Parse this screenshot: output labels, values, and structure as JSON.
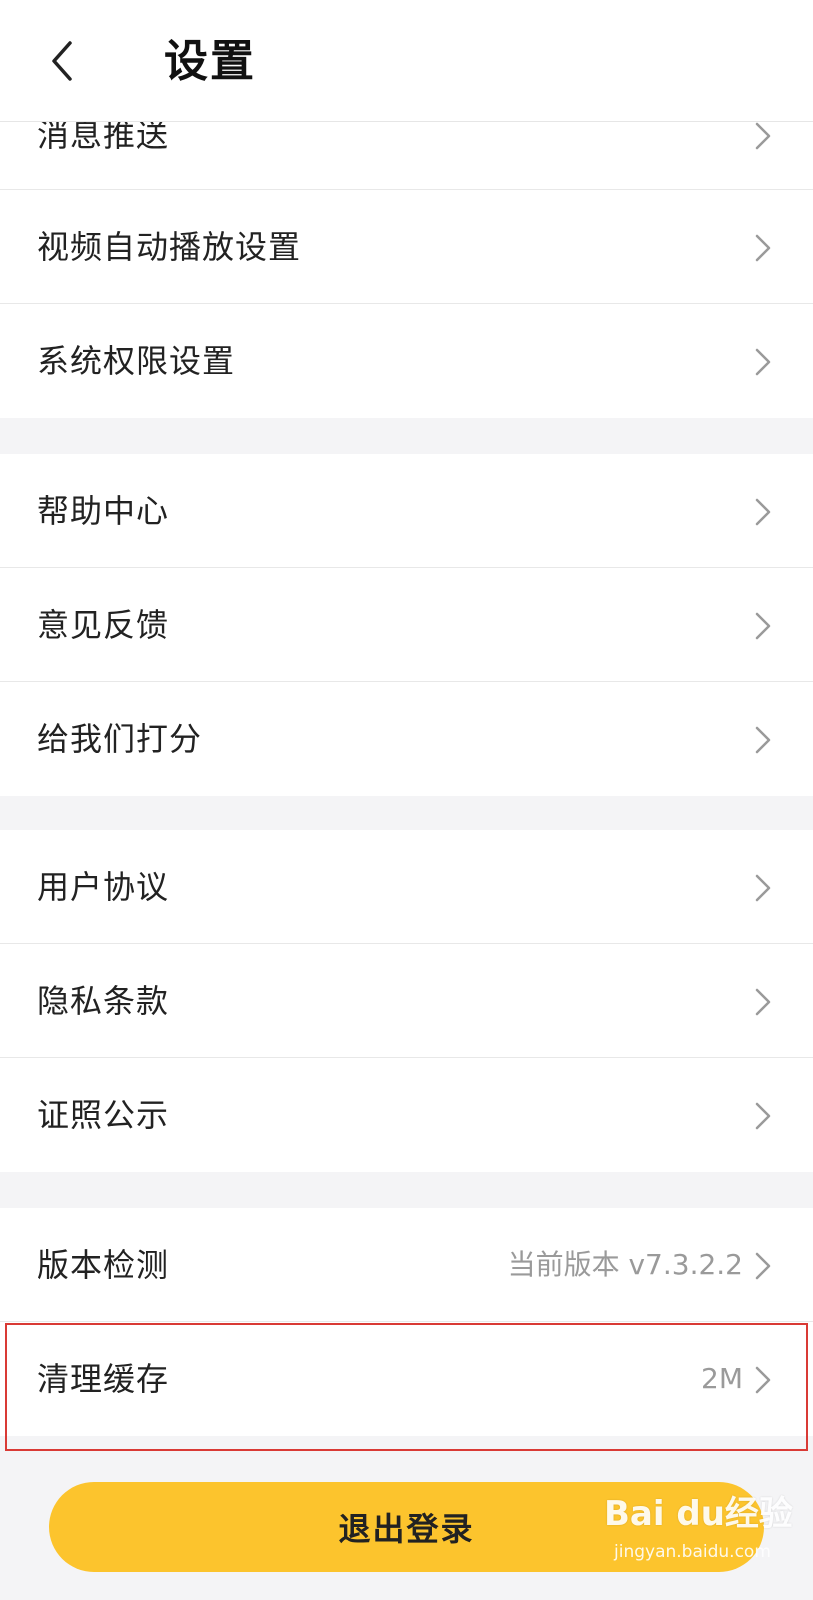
{
  "header": {
    "title": "设置",
    "back_icon": "chevron-left-icon"
  },
  "groups": [
    {
      "items": [
        {
          "label": "消息推送"
        },
        {
          "label": "视频自动播放设置"
        },
        {
          "label": "系统权限设置"
        }
      ]
    },
    {
      "items": [
        {
          "label": "帮助中心"
        },
        {
          "label": "意见反馈"
        },
        {
          "label": "给我们打分"
        }
      ]
    },
    {
      "items": [
        {
          "label": "用户协议"
        },
        {
          "label": "隐私条款"
        },
        {
          "label": "证照公示"
        }
      ]
    },
    {
      "items": [
        {
          "label": "版本检测",
          "value": "当前版本 v7.3.2.2"
        },
        {
          "label": "清理缓存",
          "value": "2M"
        }
      ]
    }
  ],
  "logout": {
    "label": "退出登录"
  },
  "watermark": {
    "logo": "Bai du经验",
    "url": "jingyan.baidu.com"
  },
  "colors": {
    "accent": "#fcc42d",
    "highlight": "#d93a35",
    "background": "#f4f4f6"
  }
}
